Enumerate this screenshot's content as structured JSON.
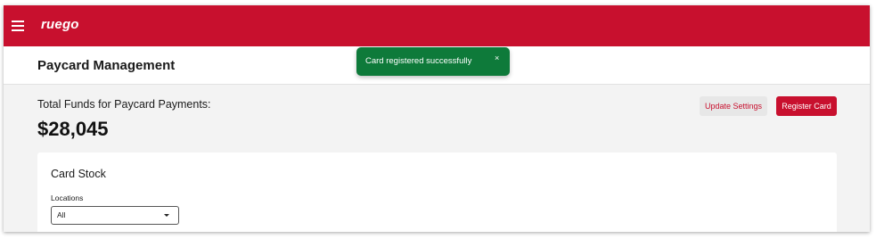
{
  "app": {
    "logo": "ruego",
    "brand_color": "#c8102e",
    "menu_icon": "hamburger-icon"
  },
  "header": {
    "title": "Paycard Management"
  },
  "toast": {
    "message": "Card registered successfully",
    "close": "×",
    "color": "#0e7a3a"
  },
  "funds": {
    "label": "Total Funds for Paycard Payments:",
    "value": "$28,045"
  },
  "actions": {
    "update_settings": "Update Settings",
    "register_card": "Register Card"
  },
  "card_stock": {
    "title": "Card Stock",
    "locations_label": "Locations",
    "locations_value": "All"
  }
}
